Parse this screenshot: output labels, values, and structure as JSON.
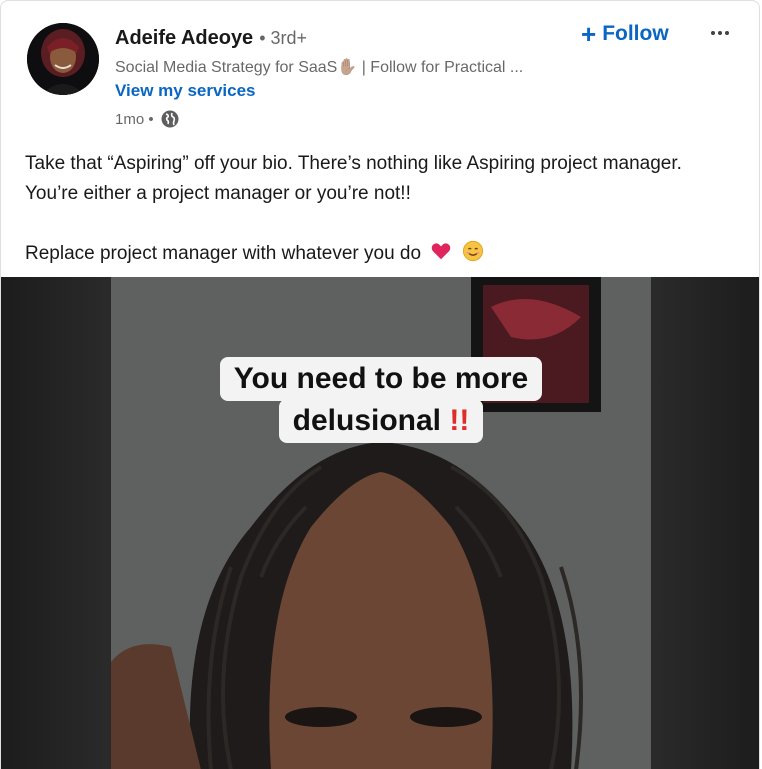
{
  "post": {
    "author": {
      "name": "Adeife Adeoye",
      "degree": "• 3rd+",
      "headline": "Social Media Strategy for SaaS✋🏾 | Follow for Practical ...",
      "services_link": "View my services",
      "time": "1mo •"
    },
    "actions": {
      "follow_plus": "+",
      "follow_label": "Follow"
    },
    "text": {
      "paragraph1": "Take that “Aspiring” off your bio. There’s nothing like Aspiring project manager. You’re either a project manager or you’re not!!",
      "paragraph2": "Replace project manager with whatever you do"
    },
    "video": {
      "caption_line1": "You need to be more",
      "caption_line2": "delusional",
      "caption_emoji": "!!"
    }
  },
  "colors": {
    "link": "#0a66c2",
    "heart": "#e0245e",
    "caption_bang": "#e12a2a"
  },
  "icons": {
    "more": "more-horizontal-icon",
    "visibility": "globe-icon",
    "heart": "heart-icon",
    "smile": "smiling-face-icon"
  }
}
